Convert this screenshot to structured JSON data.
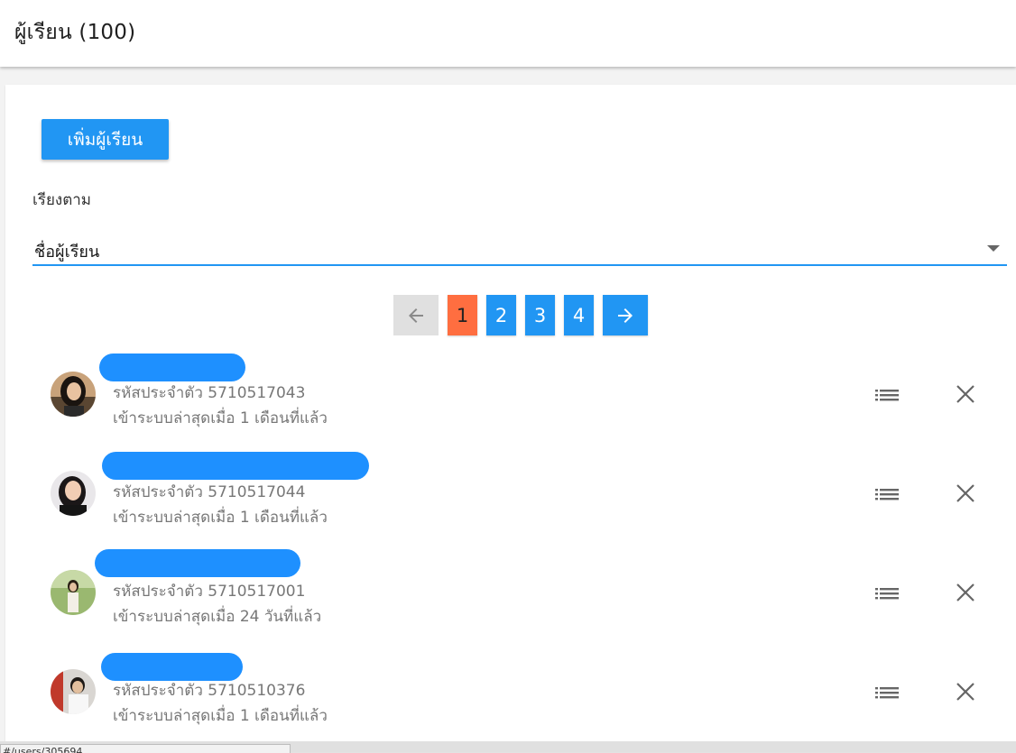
{
  "header": {
    "title": "ผู้เรียน (100)"
  },
  "toolbar": {
    "add_student_label": "เพิ่มผู้เรียน"
  },
  "sort": {
    "label": "เรียงตาม",
    "selected": "ชื่อผู้เรียน"
  },
  "pagination": {
    "pages": [
      "1",
      "2",
      "3",
      "4"
    ],
    "active_page": "1",
    "prev_icon": "arrow-left-icon",
    "next_icon": "arrow-right-icon"
  },
  "students": [
    {
      "id_text": "รหัสประจำตัว 5710517043",
      "last_login": "เข้าระบบล่าสุดเมื่อ 1 เดือนที่แล้ว"
    },
    {
      "id_text": "รหัสประจำตัว 5710517044",
      "last_login": "เข้าระบบล่าสุดเมื่อ 1 เดือนที่แล้ว"
    },
    {
      "id_text": "รหัสประจำตัว 5710517001",
      "last_login": "เข้าระบบล่าสุดเมื่อ 24 วันที่แล้ว"
    },
    {
      "id_text": "รหัสประจำตัว 5710510376",
      "last_login": "เข้าระบบล่าสุดเมื่อ 1 เดือนที่แล้ว"
    }
  ],
  "status_bar": {
    "url": "#/users/305694"
  },
  "colors": {
    "primary": "#2196f3",
    "active_page": "#ff6e40",
    "disabled": "#e0e0e0",
    "name_redaction": "#1e90ff"
  }
}
